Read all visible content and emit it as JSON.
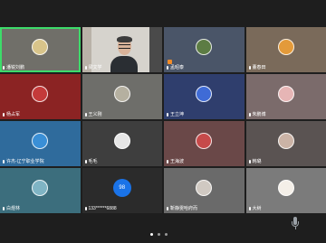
{
  "participants": [
    {
      "name": "潘锐刘鹏",
      "bg": "#706f69",
      "avatar": "#d8c48a",
      "active": true
    },
    {
      "name": "梁文学",
      "bg": "#d6d3cd",
      "camera": true
    },
    {
      "name": "孟昭泰",
      "bg": "#4a5568",
      "avatar": "#5c7c44",
      "badge": "orange"
    },
    {
      "name": "董春田",
      "bg": "#7a6a5a",
      "avatar": "#e39a3a"
    },
    {
      "name": "杨占军",
      "bg": "#8b2323",
      "avatar": "#c43a3a"
    },
    {
      "name": "王义刚",
      "bg": "#6e6e6a",
      "avatar": "#b5b0a0"
    },
    {
      "name": "王立坤",
      "bg": "#2f3e6d",
      "avatar": "#3f6bd6"
    },
    {
      "name": "朱鹏博",
      "bg": "#7b6b6b",
      "avatar": "#e6b5b5"
    },
    {
      "name": "许杰-辽宁职业学院",
      "bg": "#2f6b9c",
      "avatar": "#3a8fd6"
    },
    {
      "name": "毛毛",
      "bg": "#3e3e3e",
      "avatar": "#e6e6e6"
    },
    {
      "name": "王海波",
      "bg": "#6a4848",
      "avatar": "#c64a4a"
    },
    {
      "name": "韩璐",
      "bg": "#5a5352",
      "avatar": "#cbb3a6"
    },
    {
      "name": "白煜林",
      "bg": "#3c6e7d",
      "avatar": "#7fb4c4"
    },
    {
      "name": "133******6888",
      "bg": "#2b2b2b",
      "number": "98"
    },
    {
      "name": "靳静雯哈府而",
      "bg": "#6a6a6a",
      "avatar": "#d0c9c2"
    },
    {
      "name": "大树",
      "bg": "#7b7b7b",
      "avatar": "#f4efe8"
    }
  ],
  "self_label": "正在说话：孟昭泰",
  "pager": {
    "pages": 3,
    "current": 1
  },
  "accent": "#3ddc6a"
}
